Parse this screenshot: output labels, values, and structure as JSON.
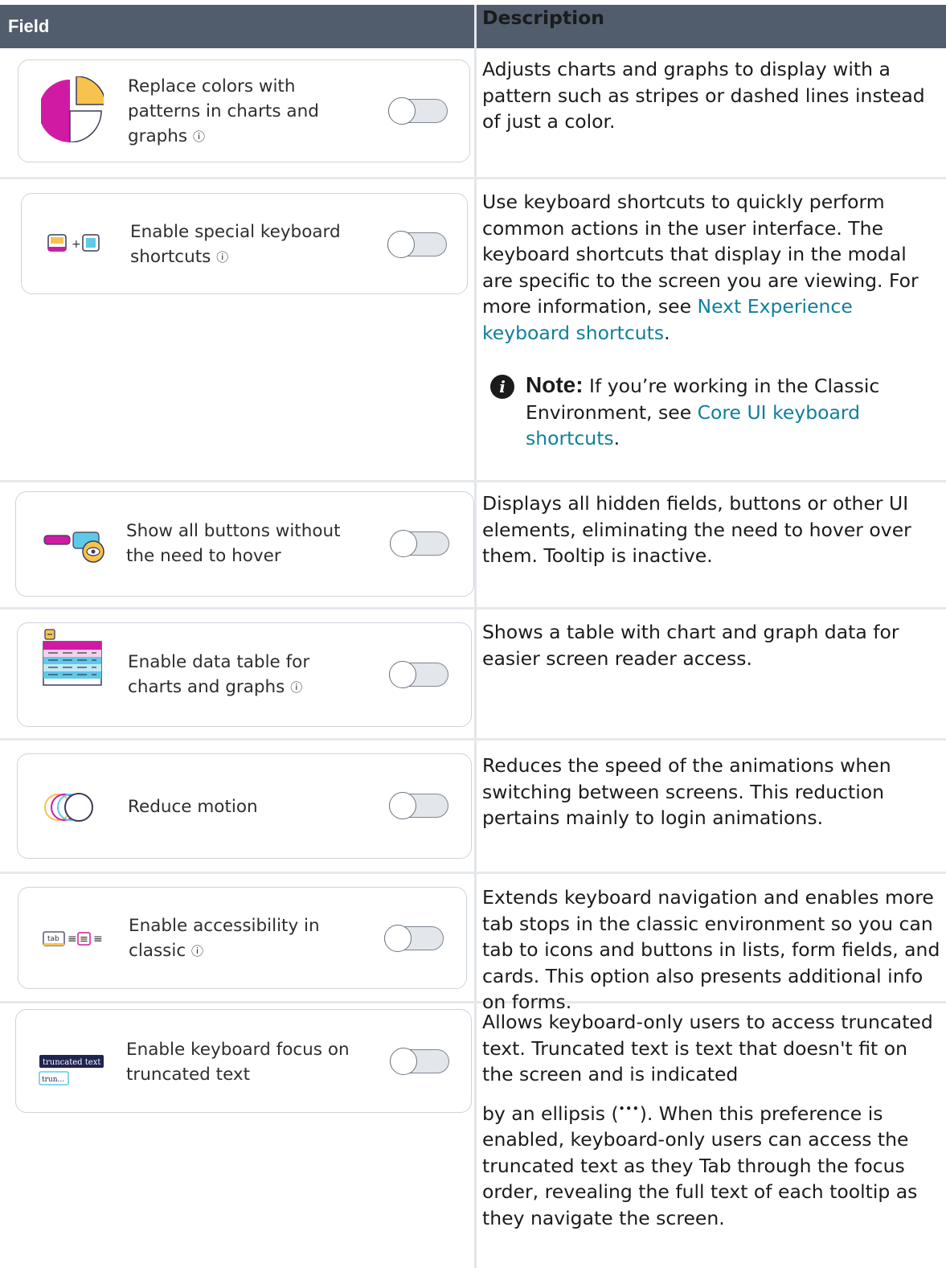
{
  "header": {
    "field": "Field",
    "description": "Description"
  },
  "rows": [
    {
      "label": "Replace colors with patterns in charts and graphs",
      "info": "ⓘ",
      "icon": "pie-chart-icon",
      "toggle_on": false,
      "description": "Adjusts charts and graphs to display with a pattern such as stripes or dashed lines instead of just a color."
    },
    {
      "label": "Enable special keyboard shortcuts",
      "info": "ⓘ",
      "icon": "keyboard-shortcut-icon",
      "toggle_on": false,
      "description": "Use keyboard shortcuts to quickly perform common actions in the user interface. The keyboard shortcuts that display in the modal are specific to the screen you are viewing. For more information, see ",
      "link": "Next Experience keyboard shortcuts",
      "after_link": ".",
      "note": {
        "title": "Note:",
        "text": "If you’re working in the Classic Environment, see ",
        "link": "Core UI keyboard shortcuts",
        "after_link": "."
      }
    },
    {
      "label": "Show all buttons without the need to hover",
      "icon": "hover-buttons-icon",
      "toggle_on": false,
      "description": "Displays all hidden fields, buttons or other UI elements, eliminating the need to hover over them. Tooltip is inactive."
    },
    {
      "label": "Enable data table for charts and graphs",
      "info": "ⓘ",
      "icon": "data-table-icon",
      "toggle_on": false,
      "description": "Shows a table with chart and graph data for easier screen reader access."
    },
    {
      "label": "Reduce motion",
      "icon": "motion-circles-icon",
      "toggle_on": false,
      "description": "Reduces the speed of the animations when switching between screens. This reduction pertains mainly to login animations."
    },
    {
      "label": "Enable accessibility in classic",
      "info": "ⓘ",
      "icon": "tab-stops-icon",
      "icon_text": "tab",
      "toggle_on": false,
      "description": "Extends keyboard navigation and enables more tab stops in the classic environment so you can tab to icons and buttons in lists, form fields, and cards. This option also presents additional info on forms."
    },
    {
      "label": "Enable keyboard focus on truncated text",
      "icon": "truncated-text-icon",
      "icon_text_full": "truncated text",
      "icon_text_short": "trun...",
      "toggle_on": false,
      "description_1": "Allows keyboard-only users to access truncated text. Truncated text is text that doesn't fit on the screen and is indicated",
      "description_2": "by an ellipsis (",
      "ellipsis": "•••",
      "description_3": "). When this preference is enabled, keyboard-only users can access the truncated text as they Tab through the focus order, revealing the full text of each tooltip as they navigate the screen."
    }
  ]
}
